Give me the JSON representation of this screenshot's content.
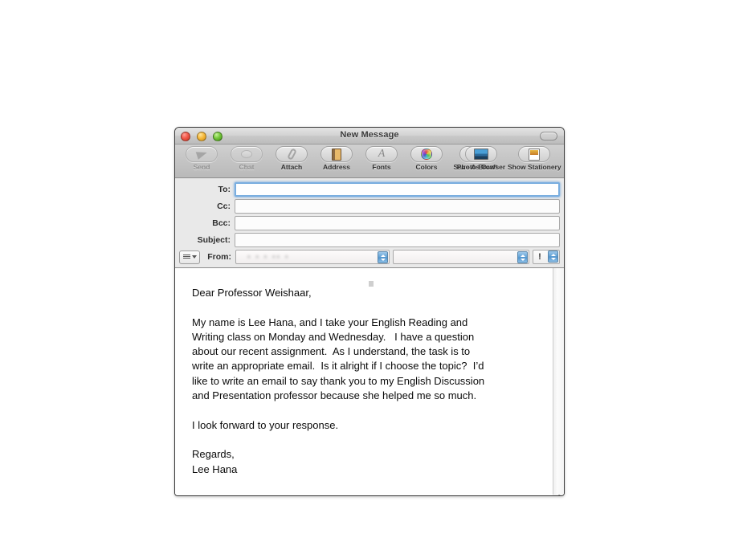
{
  "window": {
    "title": "New Message",
    "traffic_lights": [
      "close",
      "minimize",
      "zoom"
    ],
    "toolbar_toggle": "toolbar-toggle-pill"
  },
  "toolbar": {
    "left_items": [
      {
        "label": "Send",
        "icon": "send-icon",
        "disabled": true
      },
      {
        "label": "Chat",
        "icon": "chat-icon",
        "disabled": true
      },
      {
        "label": "Attach",
        "icon": "paperclip-icon",
        "disabled": false
      },
      {
        "label": "Address",
        "icon": "address-book-icon",
        "disabled": false
      },
      {
        "label": "Fonts",
        "icon": "fonts-icon",
        "disabled": false
      },
      {
        "label": "Colors",
        "icon": "color-wheel-icon",
        "disabled": false
      },
      {
        "label": "Save As Draft",
        "icon": "draft-icon",
        "disabled": false
      }
    ],
    "right_items": [
      {
        "label": "Photo Browser",
        "icon": "photo-browser-icon",
        "disabled": false
      },
      {
        "label": "Show Stationery",
        "icon": "stationery-icon",
        "disabled": false
      }
    ]
  },
  "headers": {
    "to": {
      "label": "To:",
      "value": "",
      "focused": true
    },
    "cc": {
      "label": "Cc:",
      "value": ""
    },
    "bcc": {
      "label": "Bcc:",
      "value": ""
    },
    "subject": {
      "label": "Subject:",
      "value": ""
    },
    "from": {
      "label": "From:",
      "account": "▪   ▪   ▪  ▪▪   ▪",
      "signature": ""
    },
    "layout_button": "header-layout-menu",
    "priority_button": "!"
  },
  "message": {
    "body": "Dear Professor Weishaar,\n\nMy name is Lee Hana, and I take your English Reading and\nWriting class on Monday and Wednesday.   I have a question\nabout our recent assignment.  As I understand, the task is to\nwrite an appropriate email.  Is it alright if I choose the topic?  I’d\nlike to write an email to say thank you to my English Discussion\nand Presentation professor because she helped me so much.\n\nI look forward to your response.\n\nRegards,\nLee Hana"
  },
  "colors": {
    "focus_ring": "#7aaee0",
    "titlebar": "#c9c9c9",
    "toolbar": "#c4c4c4",
    "header_bg": "#e9e9e9",
    "body_bg": "#ffffff"
  }
}
